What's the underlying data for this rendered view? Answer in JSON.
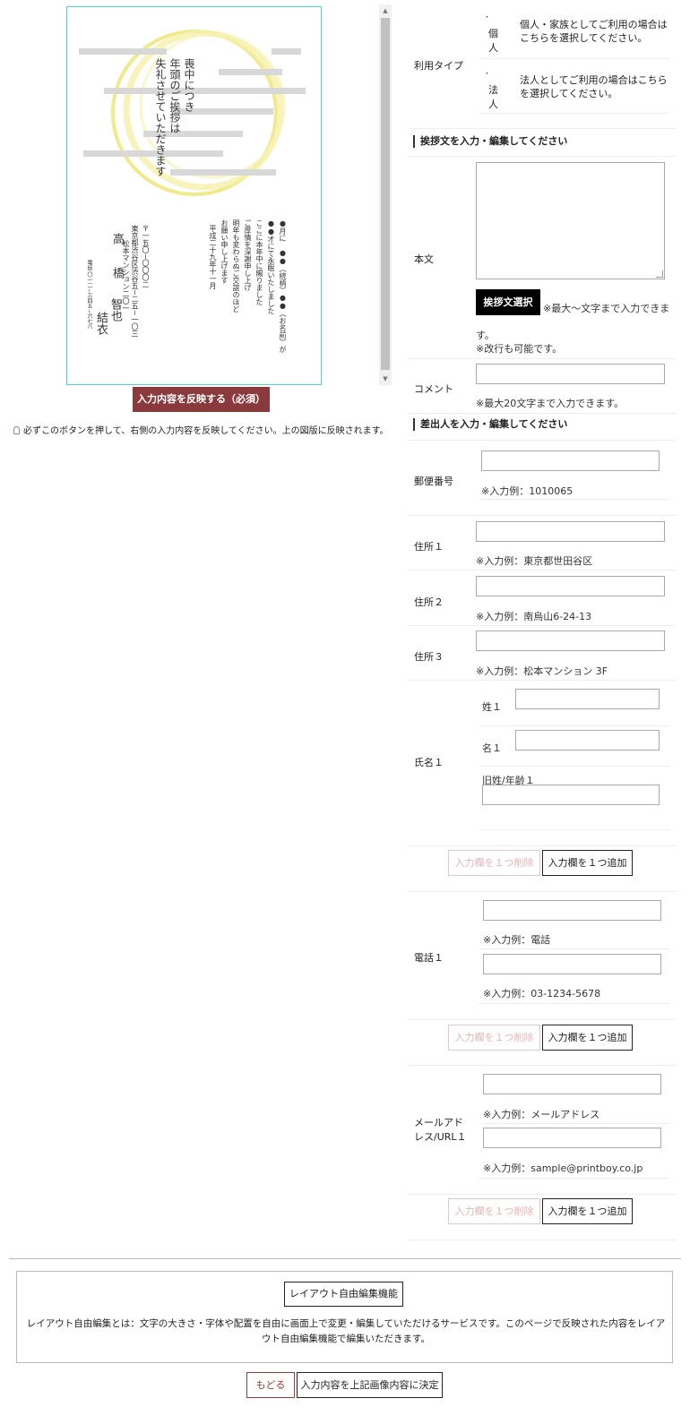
{
  "preview": {
    "title_col1": "喪中につき",
    "title_col2": "年頭のご挨拶は",
    "title_col3": "失礼させていただきます",
    "body_col1": "●月に　●●（続柄）●●（お名前）が",
    "body_col2": "●●才にて永眠いたしました",
    "body_col3": "ここに本年中に賜りました",
    "body_col4": "ご厚情を深謝申し上げ",
    "body_col5": "明年も変わらぬご交誼のほど",
    "body_col6": "お願い申し上げます",
    "body_col7": "平成二十九年十一月",
    "addr_col1": "〒一五〇−〇〇〇二",
    "addr_col2": "東京都渋谷区渋谷五−二五−一〇三",
    "addr_col3": "松本マンション二〇一",
    "tel": "電話 〇一二−三四五−六七八",
    "name1_a": "高",
    "name1_b": "橋",
    "name2": "智也",
    "name3": "結衣"
  },
  "reflect_button": "入力内容を反映する（必須）",
  "notice": "必ずこのボタンを押して、右側の入力内容を反映してください。上の図版に反映されます。",
  "form": {
    "usage_type": {
      "label": "利用タイプ",
      "options": [
        {
          "name": "個人",
          "desc1": "個人・家族としてご利用の場合は",
          "desc2": "こちらを選択してください。"
        },
        {
          "name": "法人",
          "desc1": "法人としてご利用の場合はこちら",
          "desc2": "を選択してください。"
        }
      ]
    },
    "greeting_section": "挨拶文を入力・編集してください",
    "body": {
      "label": "本文",
      "button": "挨拶文選択",
      "note1": "※最大〜文字まで入力できま",
      "note2": "す。",
      "note3": "※改行も可能です。"
    },
    "comment": {
      "label": "コメント",
      "note": "※最大20文字まで入力できます。"
    },
    "sender_section": "差出人を入力・編集してください",
    "postal": {
      "label": "郵便番号",
      "hint": "※入力例：1010065"
    },
    "address1": {
      "label": "住所１",
      "hint": "※入力例：東京都世田谷区"
    },
    "address2": {
      "label": "住所２",
      "hint": "※入力例：南烏山6-24-13"
    },
    "address3": {
      "label": "住所３",
      "hint": "※入力例：松本マンション 3F"
    },
    "name": {
      "label": "氏名１",
      "sei": "姓１",
      "mei": "名１",
      "kyusei": "旧姓/年齢１"
    },
    "phone": {
      "label": "電話１",
      "hint1": "※入力例：電話",
      "hint2": "※入力例：03-1234-5678"
    },
    "mail": {
      "label1": "メールアド",
      "label2": "レス/URL１",
      "hint1": "※入力例：メールアドレス",
      "hint2": "※入力例：sample@printboy.co.jp"
    },
    "del_button": "入力欄を１つ削除",
    "add_button": "入力欄を１つ追加"
  },
  "free_layout": {
    "button": "レイアウト自由編集機能",
    "desc": "レイアウト自由編集とは：文字の大きさ・字体や配置を自由に画面上で変更・編集していただけるサービスです。このページで反映された内容をレイアウト自由編集機能で編集いただきます。"
  },
  "footer": {
    "back": "もどる",
    "decide": "入力内容を上記画像内容に決定"
  },
  "colors": {
    "primary_dark_red": "#8a3a3c",
    "preview_border": "#4dd4d4",
    "moon_yellow": "#f0e68c"
  }
}
